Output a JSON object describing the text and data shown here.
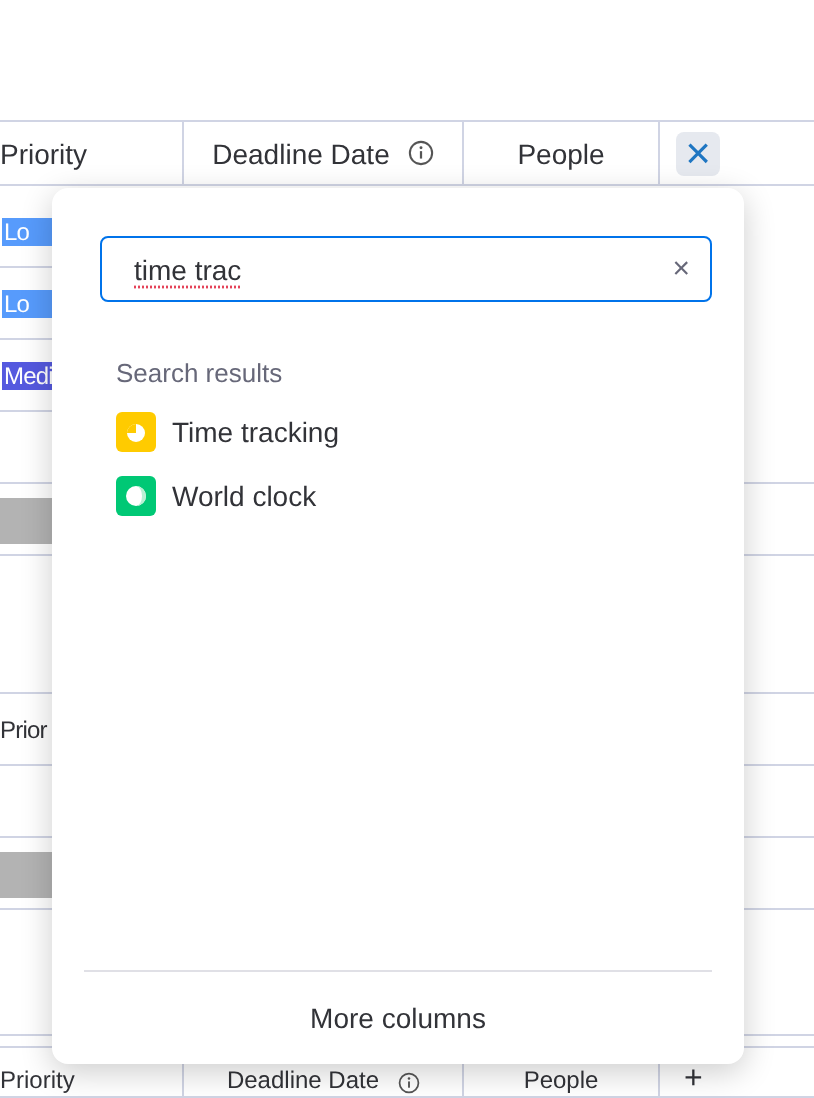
{
  "header_top": {
    "columns": [
      "Priority",
      "Deadline Date",
      "People"
    ],
    "action": "×"
  },
  "rows": [
    {
      "kind": "status",
      "label": "Lo",
      "color": "#579bfc"
    },
    {
      "kind": "status",
      "label": "Lo",
      "color": "#579bfc"
    },
    {
      "kind": "status",
      "label": "Medi",
      "color": "#5559df"
    },
    {
      "kind": "empty"
    },
    {
      "kind": "bar"
    },
    {
      "kind": "tall"
    },
    {
      "kind": "label",
      "label": "Prior"
    },
    {
      "kind": "empty"
    },
    {
      "kind": "bar"
    },
    {
      "kind": "tall"
    }
  ],
  "header_bottom": {
    "columns": [
      "Priority",
      "Deadline Date",
      "People"
    ],
    "action": "+"
  },
  "popup": {
    "search": {
      "value": "time trac"
    },
    "clear": "×",
    "section_title": "Search results",
    "results": [
      {
        "kind": "timer",
        "label": "Time tracking",
        "color": "#ffcb00"
      },
      {
        "kind": "clock",
        "label": "World clock",
        "color": "#00c875"
      }
    ],
    "footer": "More columns"
  }
}
